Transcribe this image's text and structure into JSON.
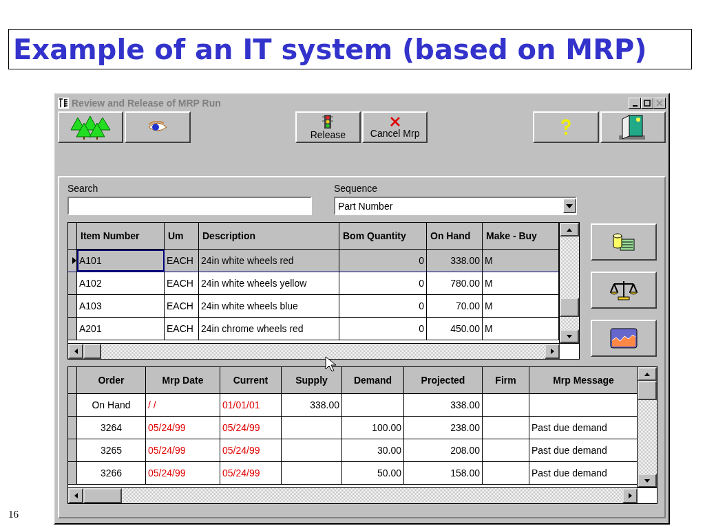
{
  "slide": {
    "title": "Example of an IT system (based on MRP)",
    "page_number": "16"
  },
  "window": {
    "title": "Review and Release of MRP Run"
  },
  "toolbar": [
    {
      "label": "Release"
    },
    {
      "label": "Cancel Mrp"
    }
  ],
  "search": {
    "label": "Search"
  },
  "sequence": {
    "label": "Sequence",
    "value": "Part Number"
  },
  "items_table": {
    "columns": [
      {
        "label": "Item Number",
        "kind": "text"
      },
      {
        "label": "Um",
        "kind": "text"
      },
      {
        "label": "Description",
        "kind": "text"
      },
      {
        "label": "Bom Quantity",
        "kind": "number"
      },
      {
        "label": "On Hand",
        "kind": "number"
      },
      {
        "label": "Make - Buy",
        "kind": "text"
      }
    ],
    "rows": [
      {
        "selected": true,
        "cells": [
          "A101",
          "EACH",
          "24in white wheels red",
          "0",
          "338.00",
          "M"
        ]
      },
      {
        "selected": false,
        "cells": [
          "A102",
          "EACH",
          "24in white wheels yellow",
          "0",
          "780.00",
          "M"
        ]
      },
      {
        "selected": false,
        "cells": [
          "A103",
          "EACH",
          "24in white wheels blue",
          "0",
          "70.00",
          "M"
        ]
      },
      {
        "selected": false,
        "cells": [
          "A201",
          "EACH",
          "24in chrome wheels red",
          "0",
          "450.00",
          "M"
        ]
      }
    ]
  },
  "orders_table": {
    "columns": [
      {
        "label": "Order",
        "kind": "order"
      },
      {
        "label": "Mrp Date",
        "kind": "date"
      },
      {
        "label": "Current",
        "kind": "date"
      },
      {
        "label": "Supply",
        "kind": "number"
      },
      {
        "label": "Demand",
        "kind": "number"
      },
      {
        "label": "Projected",
        "kind": "number"
      },
      {
        "label": "Firm",
        "kind": "text"
      },
      {
        "label": "Mrp Message",
        "kind": "text"
      }
    ],
    "rows": [
      {
        "cells": [
          "On Hand",
          "/ /",
          "01/01/01",
          "338.00",
          null,
          "338.00",
          null,
          null
        ]
      },
      {
        "cells": [
          "3264",
          "05/24/99",
          "05/24/99",
          null,
          "100.00",
          "238.00",
          null,
          "Past due demand"
        ]
      },
      {
        "cells": [
          "3265",
          "05/24/99",
          "05/24/99",
          null,
          "30.00",
          "208.00",
          null,
          "Past due demand"
        ]
      },
      {
        "cells": [
          "3266",
          "05/24/99",
          "05/24/99",
          null,
          "50.00",
          "158.00",
          null,
          "Past due demand"
        ]
      }
    ]
  }
}
